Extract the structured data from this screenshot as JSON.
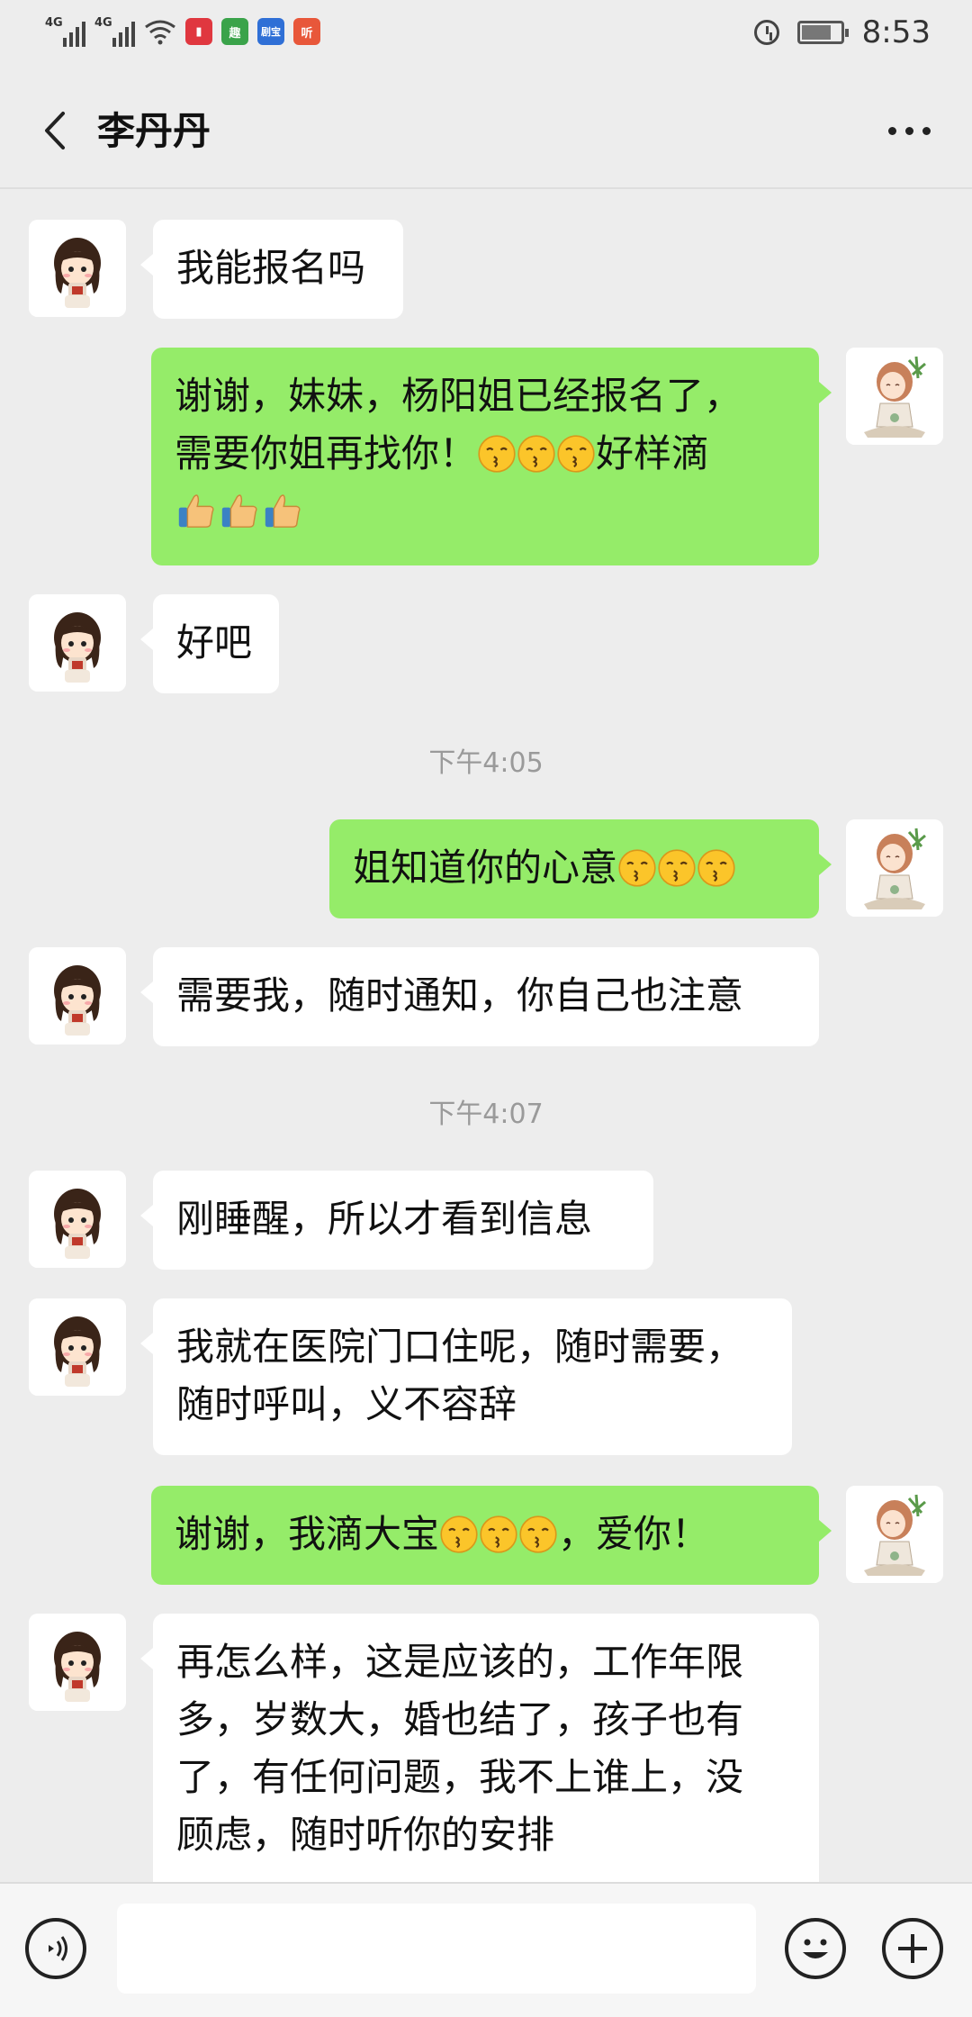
{
  "status_bar": {
    "network1": "4G",
    "network2": "4G",
    "time": "8:53",
    "app_icon_3": "趣",
    "app_icon_4": "剧宝",
    "app_icon_5": "听"
  },
  "header": {
    "title": "李丹丹",
    "back_icon": "chevron-left-icon",
    "more_icon": "more-dots-icon"
  },
  "messages": [
    {
      "side": "in",
      "text": "我能报名吗"
    },
    {
      "side": "out",
      "text_a": "谢谢，妹妹，杨阳姐已经报名了，",
      "text_b": "需要你姐再找你！",
      "text_c": "好样滴"
    },
    {
      "side": "in",
      "text": "好吧"
    },
    {
      "type": "time",
      "text": "下午4:05"
    },
    {
      "side": "out",
      "text": "姐知道你的心意"
    },
    {
      "side": "in",
      "text": "需要我，随时通知，你自己也注意"
    },
    {
      "type": "time",
      "text": "下午4:07"
    },
    {
      "side": "in",
      "text": "刚睡醒，所以才看到信息"
    },
    {
      "side": "in",
      "text_a": "我就在医院门口住呢，随时需要，",
      "text_b": "随时呼叫，义不容辞"
    },
    {
      "side": "out",
      "text_a": "谢谢，我滴大宝",
      "text_b": "，爱你！"
    },
    {
      "side": "in",
      "text_a": "再怎么样，这是应该的，工作年限",
      "text_b": "多，岁数大，婚也结了，孩子也有",
      "text_c": "了，有任何问题，我不上谁上，没",
      "text_d": "顾虑，随时听你的安排"
    }
  ],
  "input_bar": {
    "voice_icon": "voice-icon",
    "emoji_icon": "smiley-icon",
    "plus_icon": "plus-icon"
  },
  "colors": {
    "outgoing_bubble": "#95ec69",
    "incoming_bubble": "#ffffff",
    "background": "#ededed"
  }
}
